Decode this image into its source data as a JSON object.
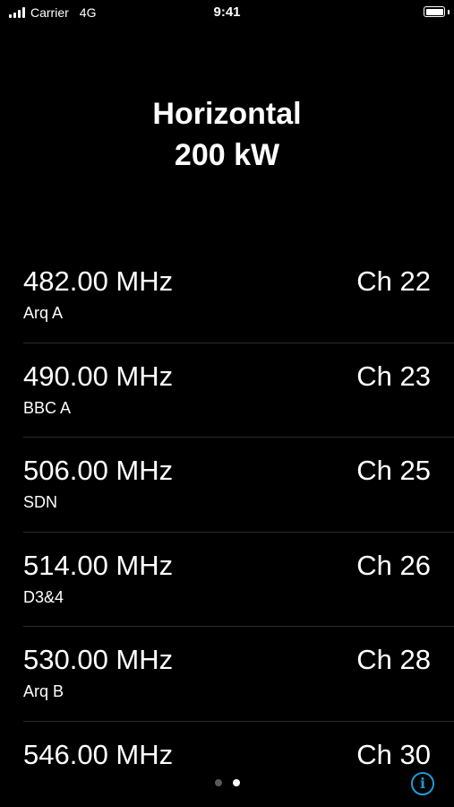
{
  "status_bar": {
    "carrier": "Carrier",
    "network": "4G",
    "time": "9:41",
    "battery_level": 1.0
  },
  "header": {
    "line1": "Horizontal",
    "line2": "200 kW"
  },
  "channels": [
    {
      "frequency": "482.00 MHz",
      "station": "Arq A",
      "channel": "Ch 22"
    },
    {
      "frequency": "490.00 MHz",
      "station": "BBC A",
      "channel": "Ch 23"
    },
    {
      "frequency": "506.00 MHz",
      "station": "SDN",
      "channel": "Ch 25"
    },
    {
      "frequency": "514.00 MHz",
      "station": "D3&4",
      "channel": "Ch 26"
    },
    {
      "frequency": "530.00 MHz",
      "station": "Arq B",
      "channel": "Ch 28"
    },
    {
      "frequency": "546.00 MHz",
      "station": "",
      "channel": "Ch 30"
    }
  ],
  "page_control": {
    "pages": 2,
    "current": 2
  },
  "info_button": {
    "icon": "info-icon",
    "glyph": "i",
    "color": "#1e9bd7"
  }
}
